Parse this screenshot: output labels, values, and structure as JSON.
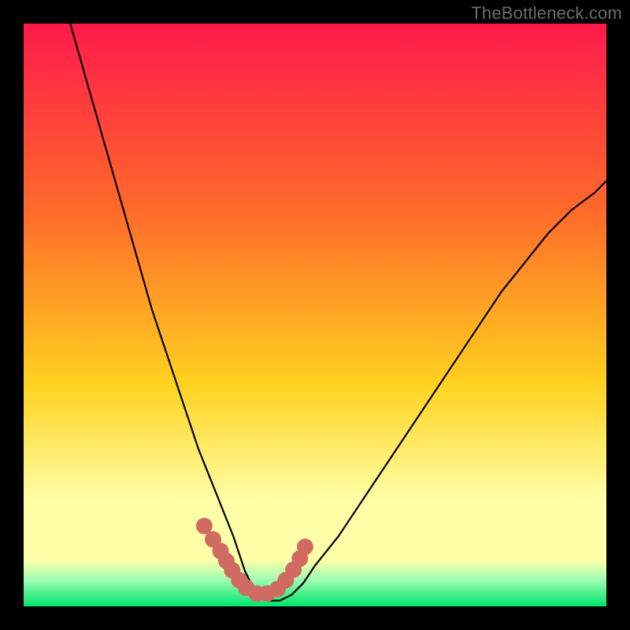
{
  "watermark": "TheBottleneck.com",
  "colors": {
    "frame_bg": "#000000",
    "grad_top": "#ff1a4b",
    "grad_mid_upper": "#ff6a2a",
    "grad_mid": "#ffd21f",
    "grad_pale_band": "#ffffa8",
    "grad_pale_green": "#9cfcb1",
    "grad_green": "#00e56a",
    "curve_stroke": "#000000",
    "marker_fill": "#d16a62",
    "marker_stroke": "#c25a52"
  },
  "chart_data": {
    "type": "line",
    "title": "",
    "xlabel": "",
    "ylabel": "",
    "xlim": [
      0,
      100
    ],
    "ylim": [
      0,
      100
    ],
    "note": "Values read from pixel positions on an unlabeled axis; x and y in percent of plot area (y=0 bottom, y=100 top).",
    "series": [
      {
        "name": "bottleneck-curve",
        "x": [
          8,
          10,
          12,
          14,
          16,
          18,
          20,
          22,
          24,
          26,
          28,
          30,
          32,
          34,
          36,
          37,
          38,
          39,
          40,
          42,
          44,
          46,
          48,
          50,
          54,
          58,
          62,
          66,
          70,
          74,
          78,
          82,
          86,
          90,
          94,
          98,
          100
        ],
        "y": [
          100,
          93,
          86,
          79,
          72,
          65,
          58,
          51,
          45,
          39,
          33,
          27,
          22,
          17,
          12,
          9,
          6,
          4,
          2,
          1,
          1,
          2,
          4,
          7,
          12,
          18,
          24,
          30,
          36,
          42,
          48,
          54,
          59,
          64,
          68,
          71,
          73
        ]
      }
    ],
    "markers": {
      "name": "highlight-band",
      "x": [
        31.0,
        32.5,
        33.8,
        34.8,
        35.8,
        37.0,
        38.2,
        40.0,
        41.8,
        43.6,
        45.0,
        46.3,
        47.4,
        48.3
      ],
      "y": [
        13.8,
        11.5,
        9.5,
        7.8,
        6.2,
        4.5,
        3.2,
        2.2,
        2.2,
        3.0,
        4.5,
        6.3,
        8.2,
        10.2
      ]
    }
  }
}
